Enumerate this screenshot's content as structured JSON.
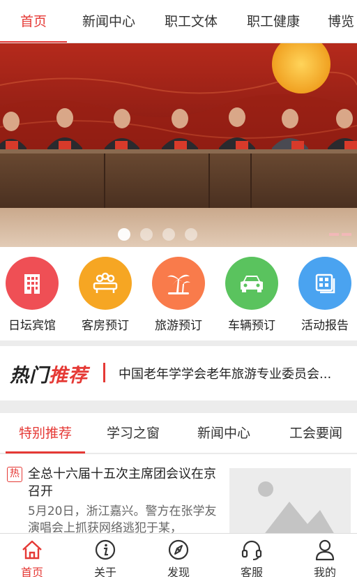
{
  "top_tabs": [
    "首页",
    "新闻中心",
    "职工文体",
    "职工健康",
    "博览"
  ],
  "banner": {
    "slide_count": 4,
    "active_slide": 1
  },
  "quick_menu": [
    {
      "label": "日坛宾馆",
      "icon": "building-icon",
      "color": "#ef4f55"
    },
    {
      "label": "客房预订",
      "icon": "meeting-table-icon",
      "color": "#f6a623"
    },
    {
      "label": "旅游预订",
      "icon": "palm-tree-icon",
      "color": "#f97b4b"
    },
    {
      "label": "车辆预订",
      "icon": "car-icon",
      "color": "#5ac35e"
    },
    {
      "label": "活动报告",
      "icon": "report-grid-icon",
      "color": "#4aa3f0"
    }
  ],
  "hot": {
    "logo_a": "热门",
    "logo_b": "推荐",
    "headline": "中国老年学学会老年旅游专业委员会..."
  },
  "section_tabs": [
    "特别推荐",
    "学习之窗",
    "新闻中心",
    "工会要闻"
  ],
  "article": {
    "badge": "热",
    "title": "全总十六届十五次主席团会议在京召开",
    "summary": "5月20日，浙江嘉兴。警方在张学友演唱会上抓获网络逃犯于某，"
  },
  "bottom_nav": [
    {
      "label": "首页",
      "icon": "home-icon"
    },
    {
      "label": "关于",
      "icon": "info-icon"
    },
    {
      "label": "发现",
      "icon": "compass-icon"
    },
    {
      "label": "客服",
      "icon": "headset-icon"
    },
    {
      "label": "我的",
      "icon": "user-icon"
    }
  ],
  "colors": {
    "accent": "#e53935"
  }
}
